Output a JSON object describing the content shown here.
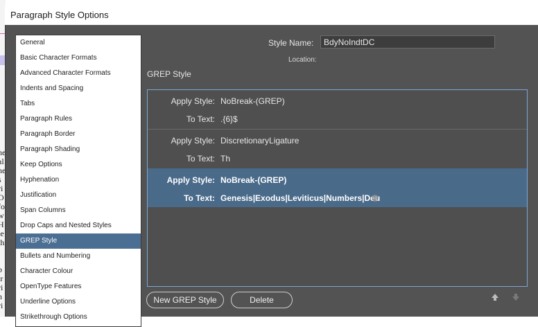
{
  "window": {
    "title": "Paragraph Style Options"
  },
  "background_doc": {
    "glyphs": [
      "he",
      "al",
      "ne",
      "s",
      "ri",
      "O",
      "fo",
      "w",
      "H",
      "ie",
      "th",
      "",
      "",
      ",",
      "b",
      "tr",
      "ri",
      "h",
      "ri",
      "b"
    ]
  },
  "sidebar": {
    "items": [
      {
        "label": "General"
      },
      {
        "label": "Basic Character Formats"
      },
      {
        "label": "Advanced Character Formats"
      },
      {
        "label": "Indents and Spacing"
      },
      {
        "label": "Tabs"
      },
      {
        "label": "Paragraph Rules"
      },
      {
        "label": "Paragraph Border"
      },
      {
        "label": "Paragraph Shading"
      },
      {
        "label": "Keep Options"
      },
      {
        "label": "Hyphenation"
      },
      {
        "label": "Justification"
      },
      {
        "label": "Span Columns"
      },
      {
        "label": "Drop Caps and Nested Styles"
      },
      {
        "label": "GREP Style"
      },
      {
        "label": "Bullets and Numbering"
      },
      {
        "label": "Character Colour"
      },
      {
        "label": "OpenType Features"
      },
      {
        "label": "Underline Options"
      },
      {
        "label": "Strikethrough Options"
      }
    ],
    "selected_index": 13
  },
  "form": {
    "style_name_label": "Style Name:",
    "style_name_value": "BdyNoIndtDC",
    "location_label": "Location:"
  },
  "grep": {
    "section_title": "GREP Style",
    "apply_label": "Apply Style:",
    "text_label": "To Text:",
    "rules": [
      {
        "apply_style": "NoBreak-(GREP)",
        "to_text": ".{6}$"
      },
      {
        "apply_style": "DiscretionaryLigature",
        "to_text": "Th"
      },
      {
        "apply_style": "NoBreak-(GREP)",
        "to_text": "Genesis|Exodus|Leviticus|Numbers|Deu"
      }
    ],
    "selected_index": 2
  },
  "buttons": {
    "new_label": "New GREP Style",
    "delete_label": "Delete"
  },
  "icons": {
    "move_up": "arrow-up-icon",
    "move_down": "arrow-down-icon"
  },
  "colors": {
    "panel_bg": "#535353",
    "selection": "#4b6e93",
    "list_border": "#7aa7d4"
  }
}
